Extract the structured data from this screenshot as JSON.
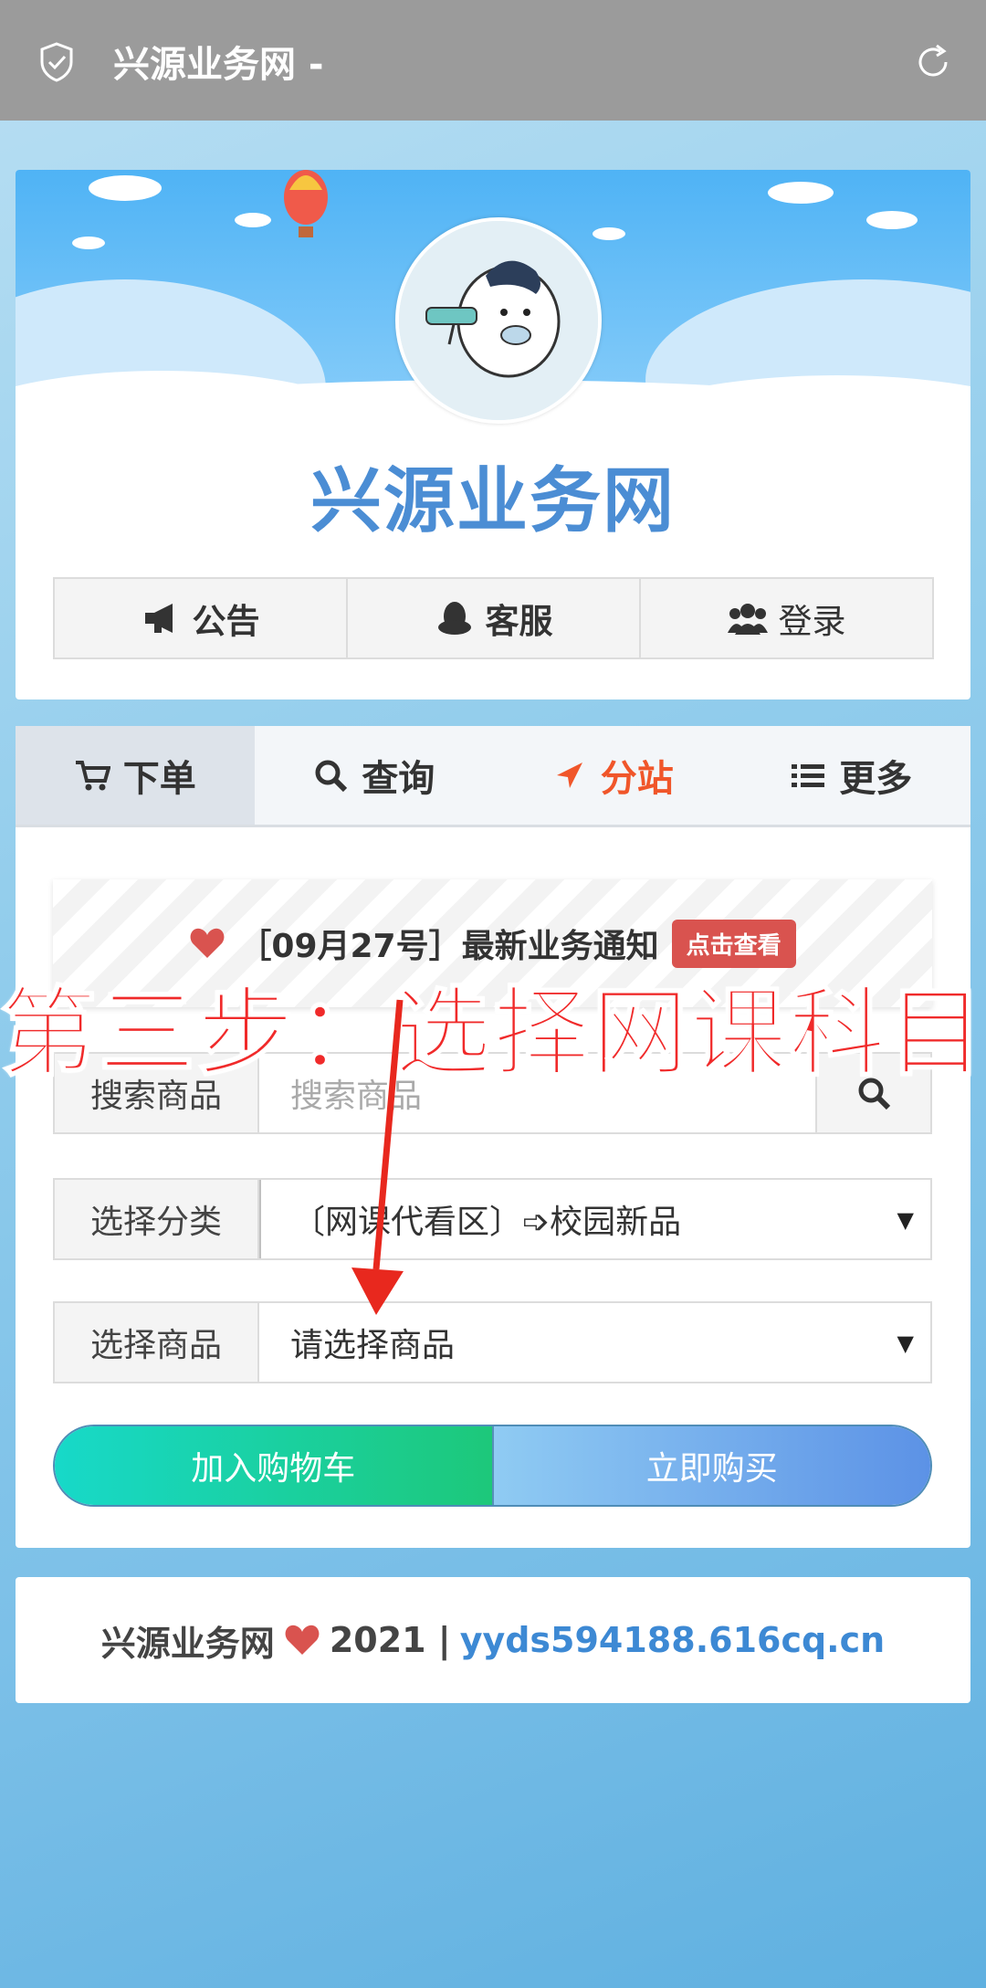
{
  "browser": {
    "title": "兴源业务网 -",
    "shield_icon": "shield-check-icon",
    "refresh_icon": "refresh-icon"
  },
  "header": {
    "site_title": "兴源业务网",
    "buttons": [
      {
        "label": "公告",
        "icon": "megaphone-icon"
      },
      {
        "label": "客服",
        "icon": "penguin-icon"
      },
      {
        "label": "登录",
        "icon": "users-icon"
      }
    ]
  },
  "tabs": [
    {
      "label": "下单",
      "icon": "cart-icon",
      "active": true
    },
    {
      "label": "查询",
      "icon": "search-icon"
    },
    {
      "label": "分站",
      "icon": "location-arrow-icon",
      "color": "#f0562a"
    },
    {
      "label": "更多",
      "icon": "list-icon"
    }
  ],
  "notice": {
    "text": "［09月27号］最新业务通知",
    "badge": "点击查看"
  },
  "overlay": {
    "step_text": "第三步：选择网课科目",
    "color": "#f02a2a"
  },
  "form": {
    "search_label": "搜索商品",
    "search_placeholder": "搜索商品",
    "category_label": "选择分类",
    "category_value": "〔网课代看区〕➩校园新品",
    "product_label": "选择商品",
    "product_value": "请选择商品"
  },
  "actions": {
    "add_cart": "加入购物车",
    "buy_now": "立即购买"
  },
  "footer": {
    "site": "兴源业务网",
    "year": "2021 |",
    "domain": "yyds594188.616cq.cn"
  },
  "colors": {
    "accent_blue": "#4b8dd4",
    "heart_red": "#d9534f",
    "orange": "#f0562a"
  }
}
